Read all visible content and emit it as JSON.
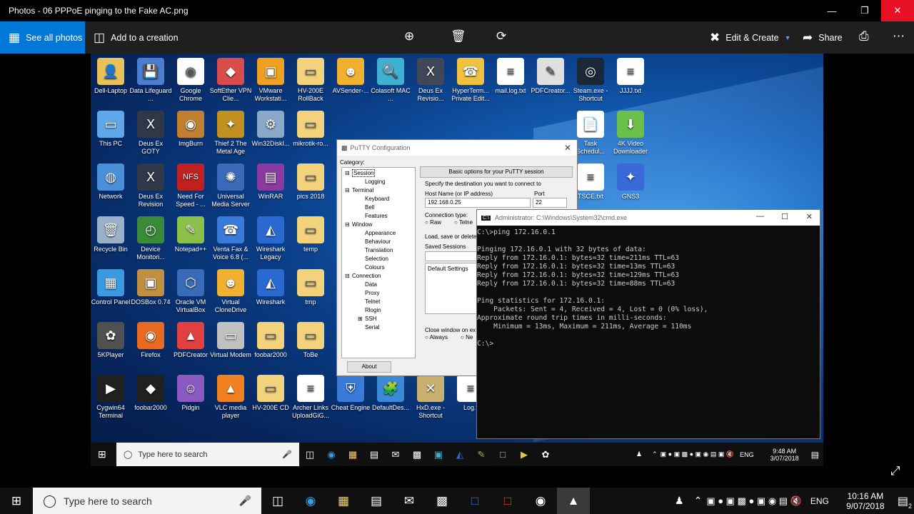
{
  "window": {
    "title": "Photos - 06 PPPoE pinging to the Fake AC.png"
  },
  "toolbar": {
    "see_all": "See all photos",
    "add_creation": "Add to a creation",
    "edit_create": "Edit & Create",
    "share": "Share"
  },
  "desktop": {
    "icons": [
      {
        "label": "Dell-Laptop",
        "color": "#e8c15a",
        "glyph": "👤"
      },
      {
        "label": "Data Lifeguard ...",
        "color": "#4a7fd0",
        "glyph": "💾"
      },
      {
        "label": "Google Chrome",
        "color": "#ffffff",
        "glyph": "◉"
      },
      {
        "label": "SoftEther VPN Clie...",
        "color": "#d94c4c",
        "glyph": "◆"
      },
      {
        "label": "VMware Workstati...",
        "color": "#f0a020",
        "glyph": "▣"
      },
      {
        "label": "HV-200E RollBack",
        "color": "#f2d27a",
        "glyph": "▭"
      },
      {
        "label": "AVSender-...",
        "color": "#f0b030",
        "glyph": "☻"
      },
      {
        "label": "Colasoft MAC ...",
        "color": "#3fb0d0",
        "glyph": "🔍"
      },
      {
        "label": "Deus Ex Revisio...",
        "color": "#404858",
        "glyph": "Ⅹ"
      },
      {
        "label": "HyperTerm... Private Edit...",
        "color": "#f0c040",
        "glyph": "☎"
      },
      {
        "label": "mail.log.txt",
        "color": "#ffffff",
        "glyph": "≡"
      },
      {
        "label": "PDFCreator...",
        "color": "#e0e0e0",
        "glyph": "✎"
      },
      {
        "label": "Steam.exe - Shortcut",
        "color": "#1b2838",
        "glyph": "◎"
      },
      {
        "label": "JJJJ.txt",
        "color": "#ffffff",
        "glyph": "≡"
      },
      {
        "label": "This PC",
        "color": "#5fa8e8",
        "glyph": "▭"
      },
      {
        "label": "Deus Ex GOTY",
        "color": "#303848",
        "glyph": "Ⅹ"
      },
      {
        "label": "ImgBurn",
        "color": "#c08030",
        "glyph": "◉"
      },
      {
        "label": "Thief 2 The Metal Age",
        "color": "#c09020",
        "glyph": "✦"
      },
      {
        "label": "Win32DiskI...",
        "color": "#8aa8c8",
        "glyph": "⚙"
      },
      {
        "label": "mikrotik-ro...",
        "color": "#f2d27a",
        "glyph": "▭"
      },
      {
        "label": "Task Schedul...",
        "color": "#ffffff",
        "glyph": "📄"
      },
      {
        "label": "4K Video Downloader",
        "color": "#6ac04a",
        "glyph": "⬇"
      },
      {
        "label": "Network",
        "color": "#4a90d8",
        "glyph": "◍"
      },
      {
        "label": "Deus Ex Revision",
        "color": "#303848",
        "glyph": "Ⅹ"
      },
      {
        "label": "Need For Speed - ...",
        "color": "#c02020",
        "glyph": "NFS"
      },
      {
        "label": "Universal Media Server",
        "color": "#3a6ab8",
        "glyph": "✺"
      },
      {
        "label": "WinRAR",
        "color": "#8a3aa0",
        "glyph": "▤"
      },
      {
        "label": "pics 2018",
        "color": "#f2d27a",
        "glyph": "▭"
      },
      {
        "label": "TSCE.txt",
        "color": "#ffffff",
        "glyph": "≡"
      },
      {
        "label": "GNS3",
        "color": "#3a6ad8",
        "glyph": "✦"
      },
      {
        "label": "Recycle Bin",
        "color": "#9ab0c8",
        "glyph": "🗑"
      },
      {
        "label": "Device Monitori...",
        "color": "#3a8a3a",
        "glyph": "◴"
      },
      {
        "label": "Notepad++",
        "color": "#8ac04a",
        "glyph": "✎"
      },
      {
        "label": "Venta Fax & Voice 6.8 (...",
        "color": "#3a7ad8",
        "glyph": "☎"
      },
      {
        "label": "Wireshark Legacy",
        "color": "#2a6ad0",
        "glyph": "◭"
      },
      {
        "label": "temp",
        "color": "#f2d27a",
        "glyph": "▭"
      },
      {
        "label": "Control Panel",
        "color": "#3a9ae0",
        "glyph": "▦"
      },
      {
        "label": "DOSBox 0.74",
        "color": "#c09040",
        "glyph": "▣"
      },
      {
        "label": "Oracle VM VirtualBox",
        "color": "#3a6ab8",
        "glyph": "⬡"
      },
      {
        "label": "Virtual CloneDrive",
        "color": "#f0b030",
        "glyph": "☻"
      },
      {
        "label": "Wireshark",
        "color": "#2a6ad0",
        "glyph": "◭"
      },
      {
        "label": "tmp",
        "color": "#f2d27a",
        "glyph": "▭"
      },
      {
        "label": "5KPlayer",
        "color": "#505050",
        "glyph": "✿"
      },
      {
        "label": "Firefox",
        "color": "#e86a20",
        "glyph": "◉"
      },
      {
        "label": "PDFCreator",
        "color": "#e04040",
        "glyph": "▲"
      },
      {
        "label": "Virtual Modem",
        "color": "#c0c0c0",
        "glyph": "▭"
      },
      {
        "label": "foobar2000",
        "color": "#f2d27a",
        "glyph": "▭"
      },
      {
        "label": "ToBe",
        "color": "#f2d27a",
        "glyph": "▭"
      },
      {
        "label": "Cygwin64 Terminal",
        "color": "#202020",
        "glyph": "▶"
      },
      {
        "label": "foobar2000",
        "color": "#202020",
        "glyph": "◆"
      },
      {
        "label": "Pidgin",
        "color": "#8a5ac0",
        "glyph": "☺"
      },
      {
        "label": "VLC media player",
        "color": "#f08020",
        "glyph": "▲"
      },
      {
        "label": "HV-200E CD",
        "color": "#f2d27a",
        "glyph": "▭"
      },
      {
        "label": "Archer Links UploadGiG...",
        "color": "#ffffff",
        "glyph": "≡"
      },
      {
        "label": "Cheat Engine",
        "color": "#3a7ad8",
        "glyph": "⛨"
      },
      {
        "label": "DefaultDes...",
        "color": "#3a8ad8",
        "glyph": "🧩"
      },
      {
        "label": "HxD.exe - Shortcut",
        "color": "#c8b070",
        "glyph": "✕"
      },
      {
        "label": "Log.t",
        "color": "#ffffff",
        "glyph": "≡"
      }
    ]
  },
  "putty": {
    "title": "PuTTY Configuration",
    "category_label": "Category:",
    "tree": [
      {
        "label": "Session",
        "indent": 1,
        "expander": "⊟",
        "selected": true
      },
      {
        "label": "Logging",
        "indent": 2
      },
      {
        "label": "Terminal",
        "indent": 1,
        "expander": "⊟"
      },
      {
        "label": "Keyboard",
        "indent": 2
      },
      {
        "label": "Bell",
        "indent": 2
      },
      {
        "label": "Features",
        "indent": 2
      },
      {
        "label": "Window",
        "indent": 1,
        "expander": "⊟"
      },
      {
        "label": "Appearance",
        "indent": 2
      },
      {
        "label": "Behaviour",
        "indent": 2
      },
      {
        "label": "Translation",
        "indent": 2
      },
      {
        "label": "Selection",
        "indent": 2
      },
      {
        "label": "Colours",
        "indent": 2
      },
      {
        "label": "Connection",
        "indent": 1,
        "expander": "⊟"
      },
      {
        "label": "Data",
        "indent": 2
      },
      {
        "label": "Proxy",
        "indent": 2
      },
      {
        "label": "Telnet",
        "indent": 2
      },
      {
        "label": "Rlogin",
        "indent": 2
      },
      {
        "label": "SSH",
        "indent": 2,
        "expander": "⊞"
      },
      {
        "label": "Serial",
        "indent": 2
      }
    ],
    "header": "Basic options for your PuTTY session",
    "specify": "Specify the destination you want to connect to",
    "host_label": "Host Name (or IP address)",
    "port_label": "Port",
    "host_value": "192.168.0.25",
    "port_value": "22",
    "conn_type": "Connection type:",
    "raw": "Raw",
    "telnet": "Telne",
    "load_save": "Load, save or delete",
    "saved_sessions": "Saved Sessions",
    "default_settings": "Default Settings",
    "close_window": "Close window on ex",
    "always": "Always",
    "never": "Ne",
    "about": "About"
  },
  "cmd": {
    "title": "Administrator: C:\\Windows\\System32\\cmd.exe",
    "lines": [
      "C:\\>ping 172.16.0.1",
      "",
      "Pinging 172.16.0.1 with 32 bytes of data:",
      "Reply from 172.16.0.1: bytes=32 time=211ms TTL=63",
      "Reply from 172.16.0.1: bytes=32 time=13ms TTL=63",
      "Reply from 172.16.0.1: bytes=32 time=129ms TTL=63",
      "Reply from 172.16.0.1: bytes=32 time=88ms TTL=63",
      "",
      "Ping statistics for 172.16.0.1:",
      "    Packets: Sent = 4, Received = 4, Lost = 0 (0% loss),",
      "Approximate round trip times in milli-seconds:",
      "    Minimum = 13ms, Maximum = 211ms, Average = 110ms",
      "",
      "C:\\>"
    ]
  },
  "inner_taskbar": {
    "search_placeholder": "Type here to search",
    "lang": "ENG",
    "time": "9:48 AM",
    "date": "3/07/2018"
  },
  "taskbar": {
    "search_placeholder": "Type here to search",
    "lang": "ENG",
    "time": "10:16 AM",
    "date": "9/07/2018",
    "notification_count": "2"
  }
}
